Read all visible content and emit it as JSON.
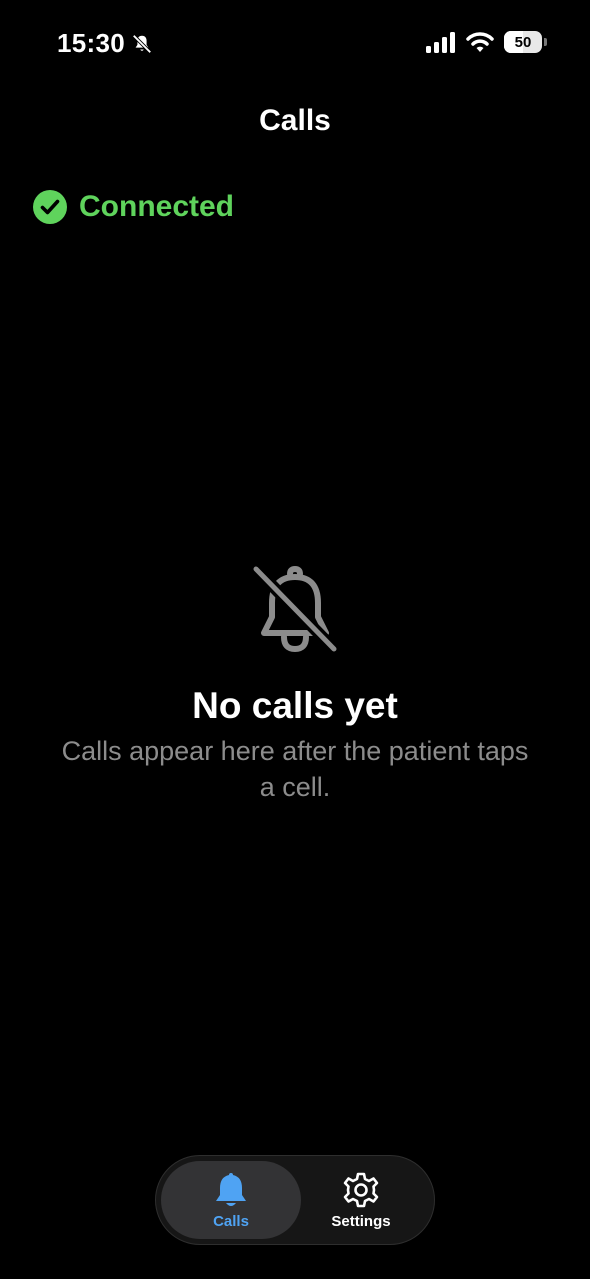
{
  "status_bar": {
    "time": "15:30",
    "battery": "50",
    "battery_fraction": 0.5
  },
  "header": {
    "title": "Calls"
  },
  "connection": {
    "label": "Connected",
    "color": "#5fd35c"
  },
  "empty_state": {
    "icon": "bell-slash-icon",
    "title": "No calls yet",
    "subtitle": "Calls appear here after the patient taps a cell."
  },
  "tab_bar": {
    "tabs": [
      {
        "label": "Calls",
        "icon": "bell-icon",
        "selected": true,
        "color": "#4fa3f3"
      },
      {
        "label": "Settings",
        "icon": "gear-icon",
        "selected": false,
        "color": "#ffffff"
      }
    ]
  }
}
